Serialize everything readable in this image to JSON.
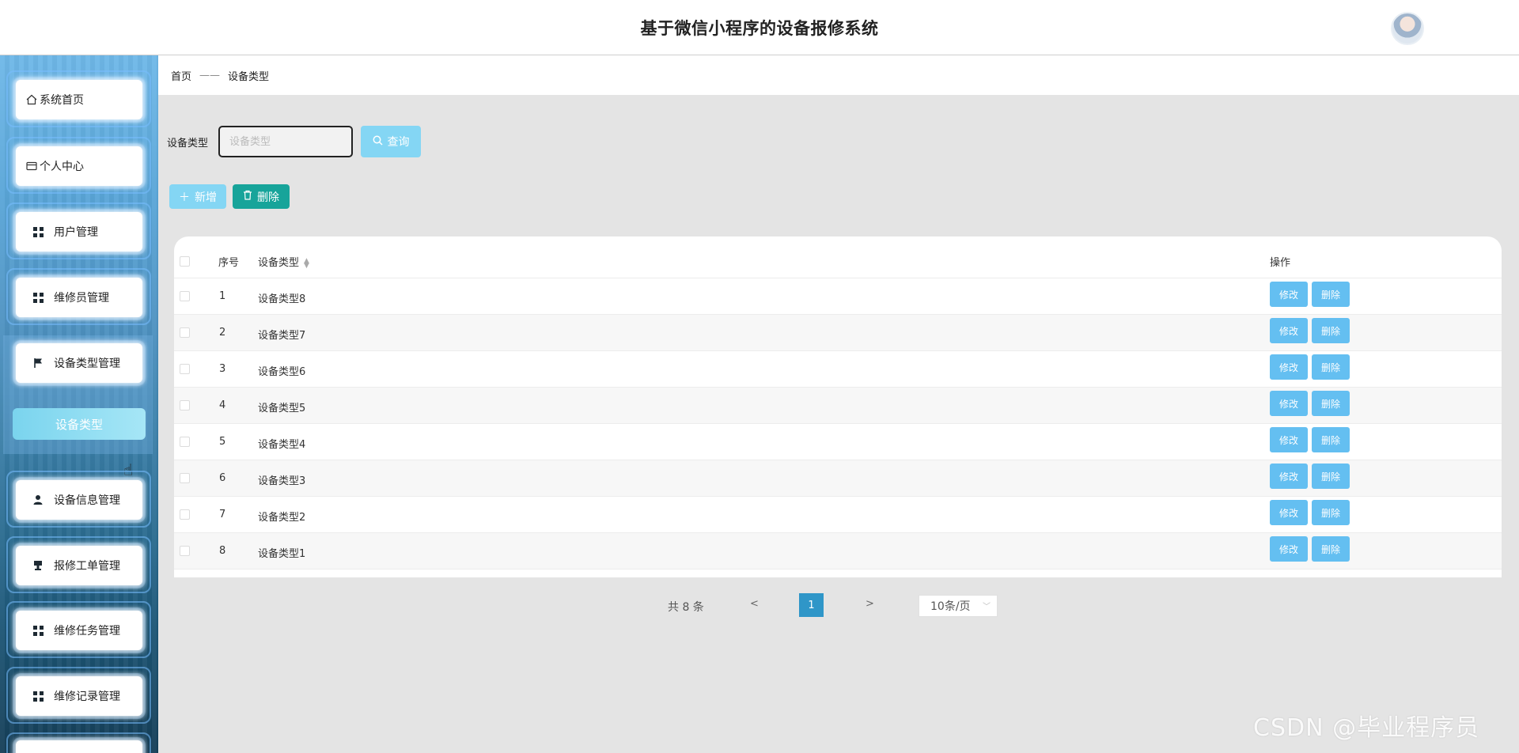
{
  "header": {
    "title": "基于微信小程序的设备报修系统"
  },
  "sidebar": {
    "items": [
      {
        "label": "系统首页",
        "icon": "home-icon"
      },
      {
        "label": "个人中心",
        "icon": "card-icon"
      },
      {
        "label": "用户管理",
        "icon": "grid-icon"
      },
      {
        "label": "维修员管理",
        "icon": "grid-icon"
      },
      {
        "label": "设备类型管理",
        "icon": "flag-icon"
      },
      {
        "label": "设备信息管理",
        "icon": "user-icon"
      },
      {
        "label": "报修工单管理",
        "icon": "stamp-icon"
      },
      {
        "label": "维修任务管理",
        "icon": "grid-icon"
      },
      {
        "label": "维修记录管理",
        "icon": "grid-icon"
      }
    ],
    "active_sub": "设备类型"
  },
  "breadcrumb": {
    "home": "首页",
    "separator": "——",
    "current": "设备类型"
  },
  "search": {
    "label": "设备类型",
    "placeholder": "设备类型",
    "query_button": "查询"
  },
  "actions": {
    "add": "新增",
    "delete": "删除"
  },
  "table": {
    "headers": {
      "index": "序号",
      "type": "设备类型",
      "ops": "操作"
    },
    "rows": [
      {
        "index": "1",
        "type": "设备类型8"
      },
      {
        "index": "2",
        "type": "设备类型7"
      },
      {
        "index": "3",
        "type": "设备类型6"
      },
      {
        "index": "4",
        "type": "设备类型5"
      },
      {
        "index": "5",
        "type": "设备类型4"
      },
      {
        "index": "6",
        "type": "设备类型3"
      },
      {
        "index": "7",
        "type": "设备类型2"
      },
      {
        "index": "8",
        "type": "设备类型1"
      }
    ],
    "edit_label": "修改",
    "delete_label": "删除"
  },
  "pagination": {
    "total": "共 8 条",
    "prev": "<",
    "current_page": "1",
    "next": ">",
    "page_size": "10条/页"
  },
  "watermark": "CSDN @毕业程序员",
  "colors": {
    "accent": "#84d6f4",
    "danger_teal": "#17a49a",
    "op_button": "#64bff1",
    "page_active": "#2f96c8"
  }
}
